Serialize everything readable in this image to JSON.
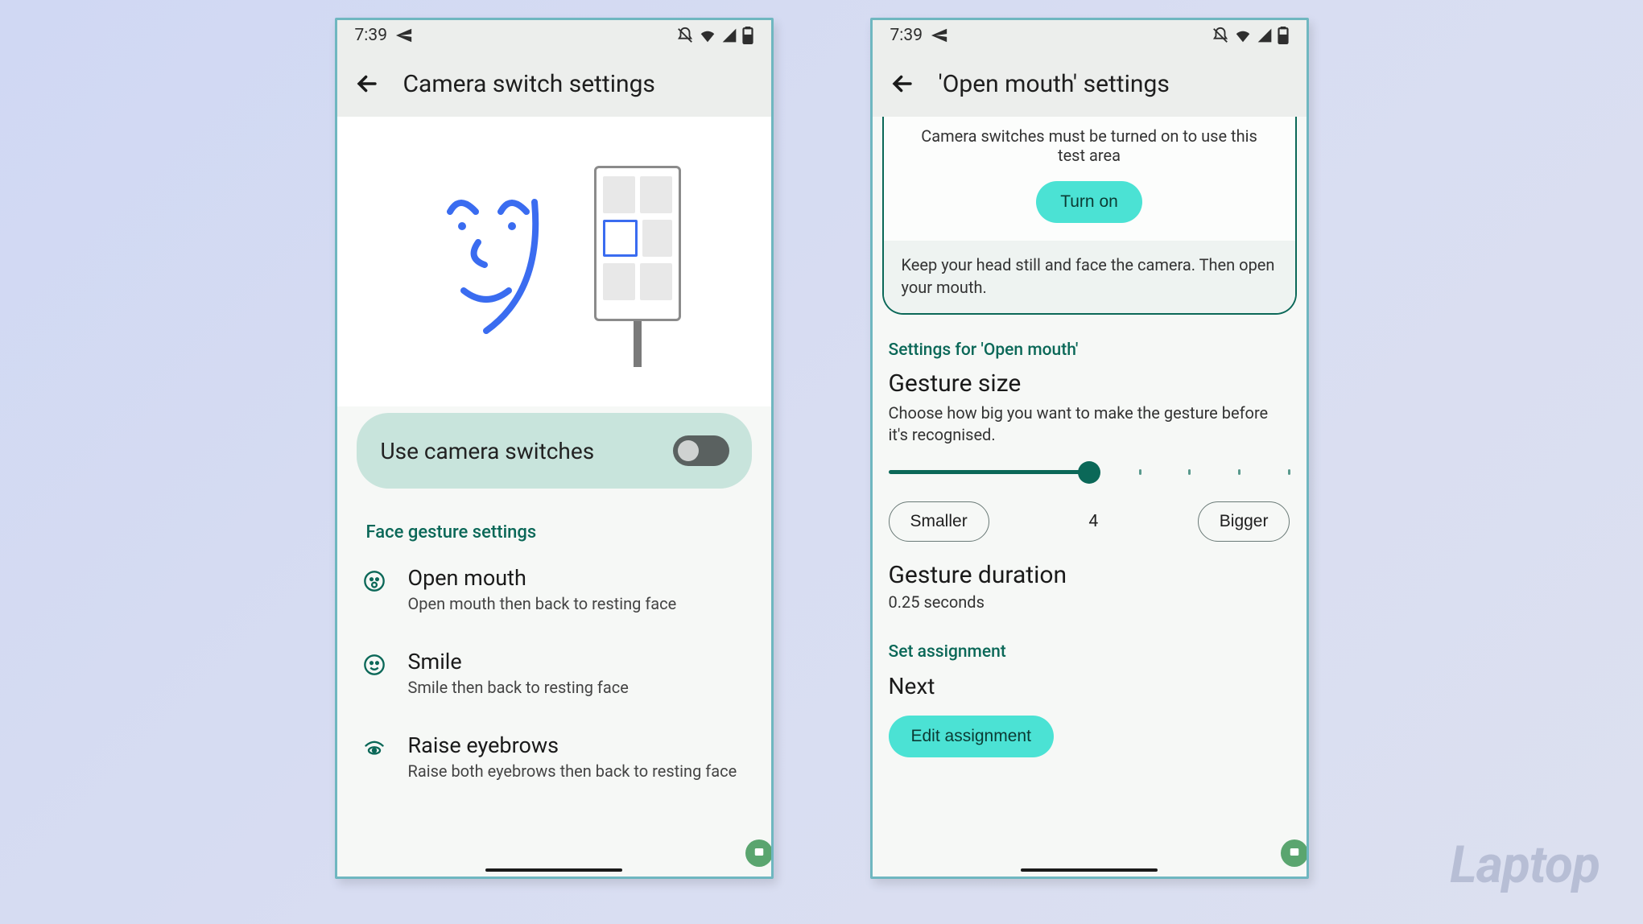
{
  "status": {
    "time": "7:39"
  },
  "phone1": {
    "title": "Camera switch settings",
    "toggle_label": "Use camera switches",
    "toggle_on": false,
    "gesture_section": "Face gesture settings",
    "gestures": [
      {
        "icon": "open-mouth",
        "title": "Open mouth",
        "subtitle": "Open mouth then back to resting face"
      },
      {
        "icon": "smile",
        "title": "Smile",
        "subtitle": "Smile then back to resting face"
      },
      {
        "icon": "eyebrows",
        "title": "Raise eyebrows",
        "subtitle": "Raise both eyebrows then back to resting face"
      }
    ]
  },
  "phone2": {
    "title": "'Open mouth' settings",
    "test_notice": "Camera switches must be turned on to use this test area",
    "turn_on": "Turn on",
    "test_instruction": "Keep your head still and face the camera. Then open your mouth.",
    "settings_for": "Settings for 'Open mouth'",
    "gesture_size_heading": "Gesture size",
    "gesture_size_desc": "Choose how big you want to make the gesture before it's recognised.",
    "smaller": "Smaller",
    "size_value": "4",
    "bigger": "Bigger",
    "duration_heading": "Gesture duration",
    "duration_value": "0.25 seconds",
    "set_assignment": "Set assignment",
    "next": "Next",
    "edit_assignment": "Edit assignment"
  },
  "watermark": "Laptop"
}
